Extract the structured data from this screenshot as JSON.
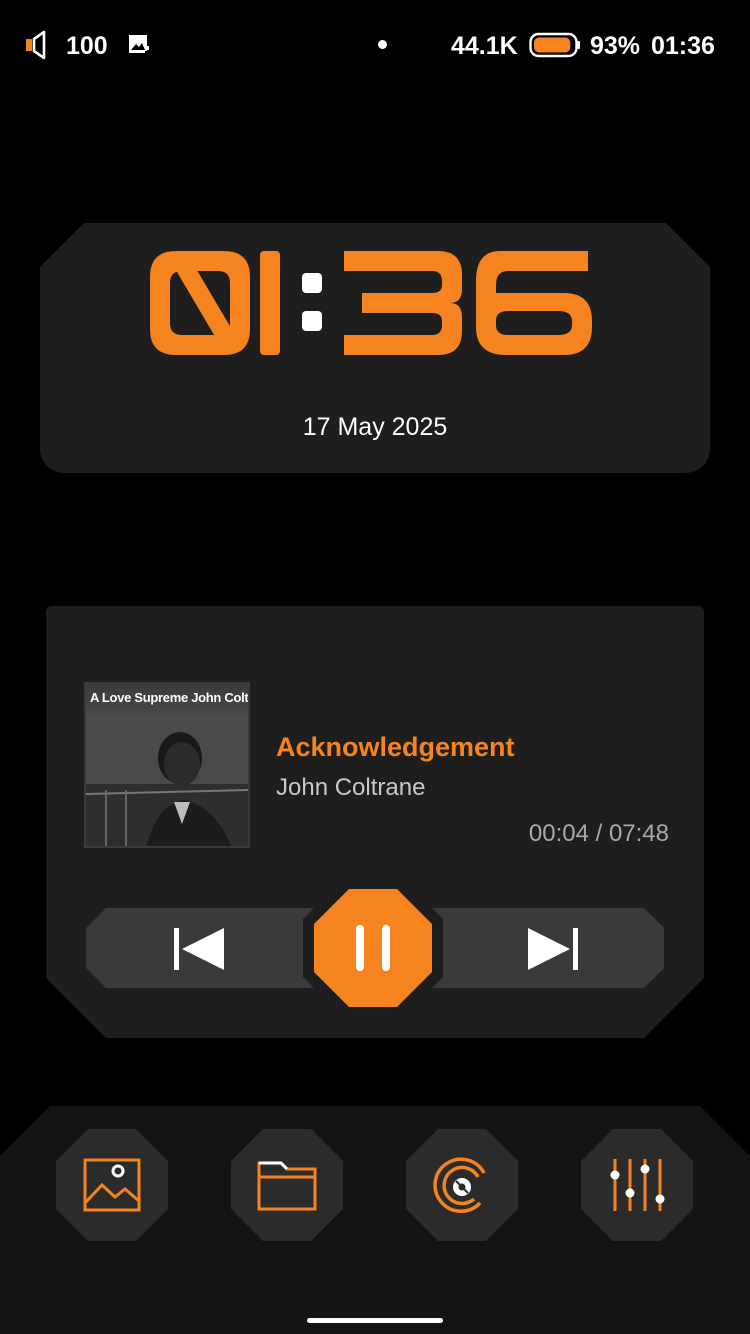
{
  "colors": {
    "accent": "#f5831f",
    "card": "#1e1e1e",
    "background": "#000000"
  },
  "status_bar": {
    "volume_icon": "volume-icon",
    "volume": "100",
    "image_icon": "image-icon",
    "sample_rate": "44.1K",
    "battery_percent": "93%",
    "battery_level": 0.93,
    "time": "01:36"
  },
  "clock_widget": {
    "time_hours": "01",
    "time_minutes": "36",
    "date": "17 May 2025"
  },
  "player": {
    "album_title": "A Love Supreme John Coltrane",
    "track_title": "Acknowledgement",
    "artist": "John Coltrane",
    "elapsed": "00:04",
    "duration": "07:48",
    "time_display": "00:04 / 07:48",
    "controls": {
      "prev_icon": "skip-previous-icon",
      "pause_icon": "pause-icon",
      "next_icon": "skip-next-icon"
    }
  },
  "dock": {
    "items": [
      {
        "icon": "gallery-icon"
      },
      {
        "icon": "folder-icon"
      },
      {
        "icon": "vinyl-icon"
      },
      {
        "icon": "equalizer-icon"
      }
    ]
  }
}
